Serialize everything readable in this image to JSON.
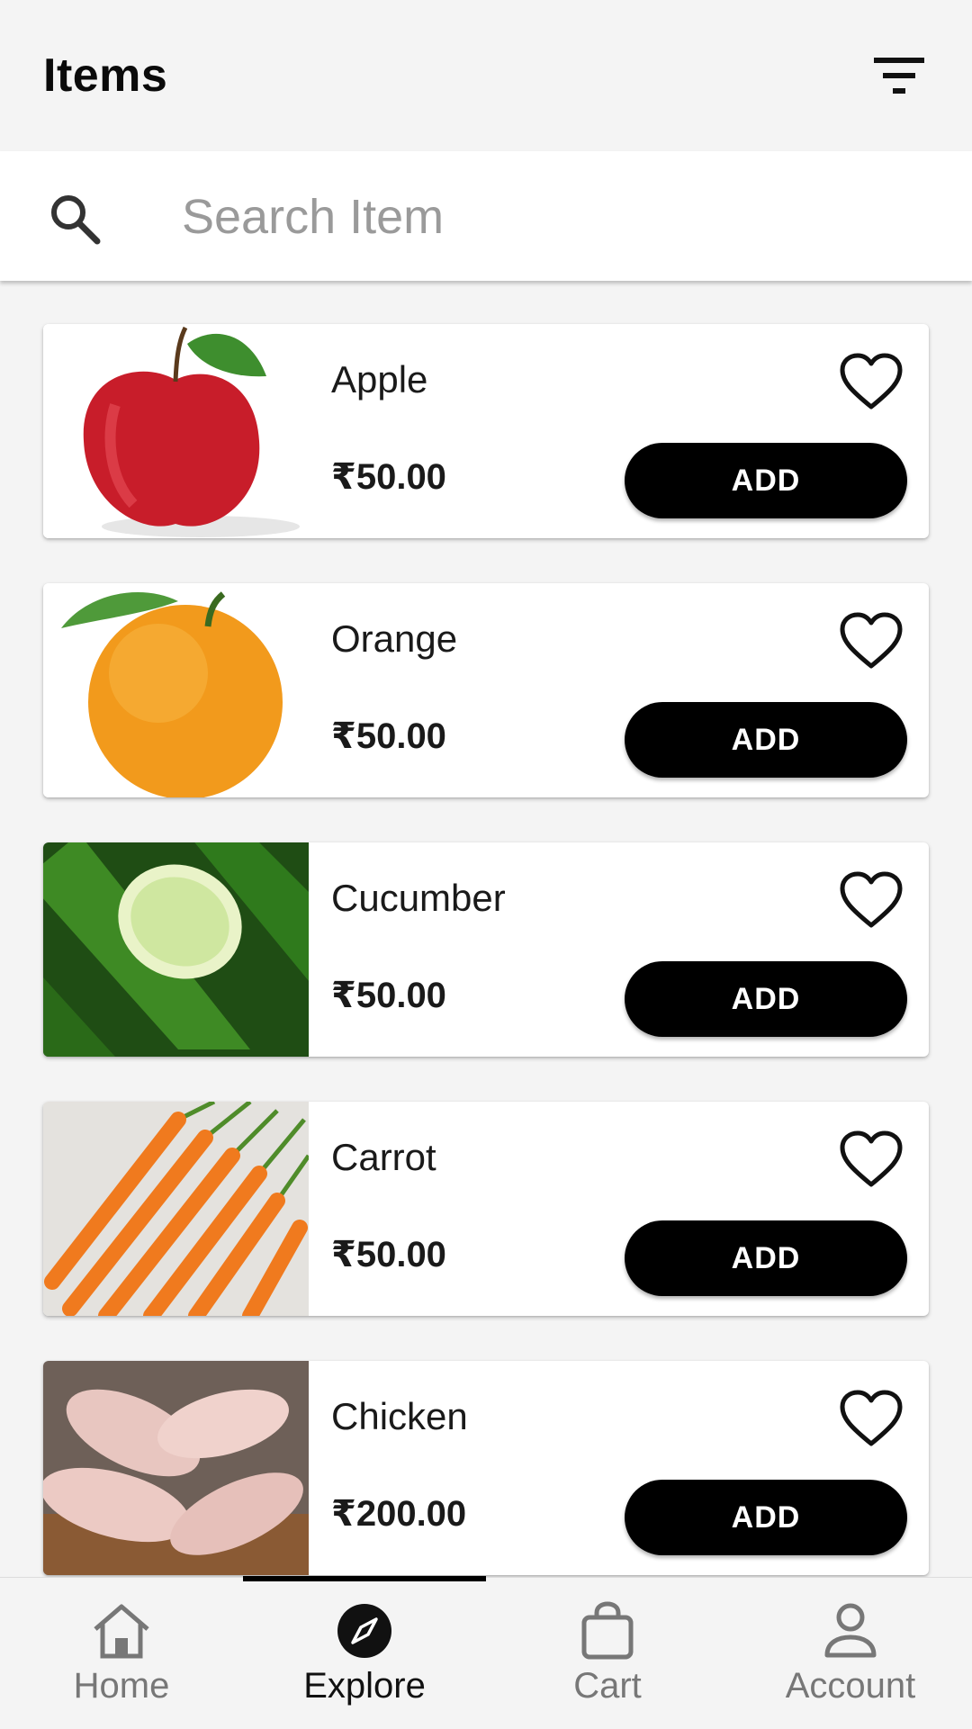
{
  "header": {
    "title": "Items",
    "filter_icon": "filter-icon"
  },
  "search": {
    "placeholder": "Search Item",
    "value": "",
    "icon": "search-icon"
  },
  "currency_symbol": "₹",
  "items": [
    {
      "name": "Apple",
      "price": "₹50.00",
      "button": "ADD",
      "image": "apple-image"
    },
    {
      "name": "Orange",
      "price": "₹50.00",
      "button": "ADD",
      "image": "orange-image"
    },
    {
      "name": "Cucumber",
      "price": "₹50.00",
      "button": "ADD",
      "image": "cucumber-image"
    },
    {
      "name": "Carrot",
      "price": "₹50.00",
      "button": "ADD",
      "image": "carrot-image"
    },
    {
      "name": "Chicken",
      "price": "₹200.00",
      "button": "ADD",
      "image": "chicken-image"
    }
  ],
  "bottom_nav": {
    "active": "Explore",
    "items": [
      {
        "label": "Home",
        "icon": "home-icon"
      },
      {
        "label": "Explore",
        "icon": "compass-icon"
      },
      {
        "label": "Cart",
        "icon": "shopping-bag-icon"
      },
      {
        "label": "Account",
        "icon": "person-icon"
      }
    ]
  },
  "colors": {
    "button_bg": "#000000",
    "button_text": "#ffffff",
    "background": "#f4f4f4",
    "card": "#ffffff"
  }
}
